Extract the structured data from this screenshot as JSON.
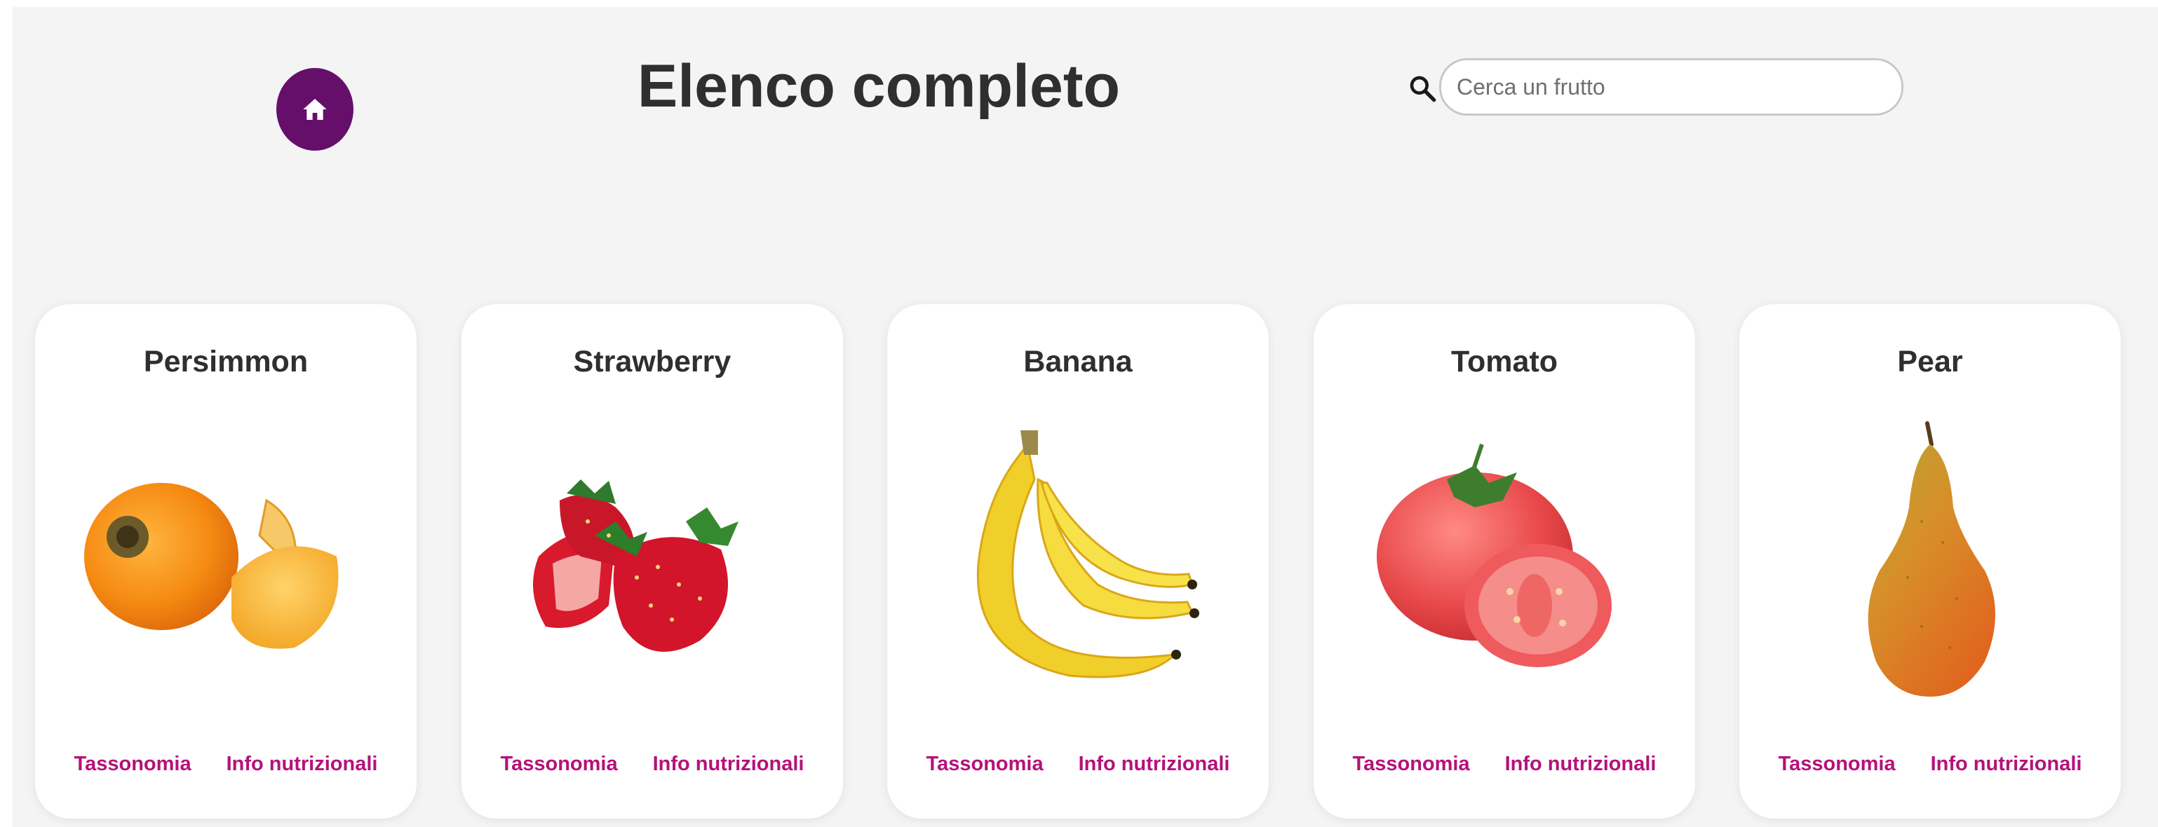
{
  "header": {
    "title": "Elenco completo",
    "home_icon": "home-icon",
    "search_icon": "search-icon",
    "search_placeholder": "Cerca un frutto",
    "search_value": ""
  },
  "colors": {
    "home_button": "#650f6b",
    "link": "#b5117b",
    "background": "#f4f4f4"
  },
  "fruits": [
    {
      "name": "Persimmon",
      "link_taxonomy": "Tassonomia",
      "link_nutrition": "Info nutrizionali"
    },
    {
      "name": "Strawberry",
      "link_taxonomy": "Tassonomia",
      "link_nutrition": "Info nutrizionali"
    },
    {
      "name": "Banana",
      "link_taxonomy": "Tassonomia",
      "link_nutrition": "Info nutrizionali"
    },
    {
      "name": "Tomato",
      "link_taxonomy": "Tassonomia",
      "link_nutrition": "Info nutrizionali"
    },
    {
      "name": "Pear",
      "link_taxonomy": "Tassonomia",
      "link_nutrition": "Info nutrizionali"
    }
  ]
}
